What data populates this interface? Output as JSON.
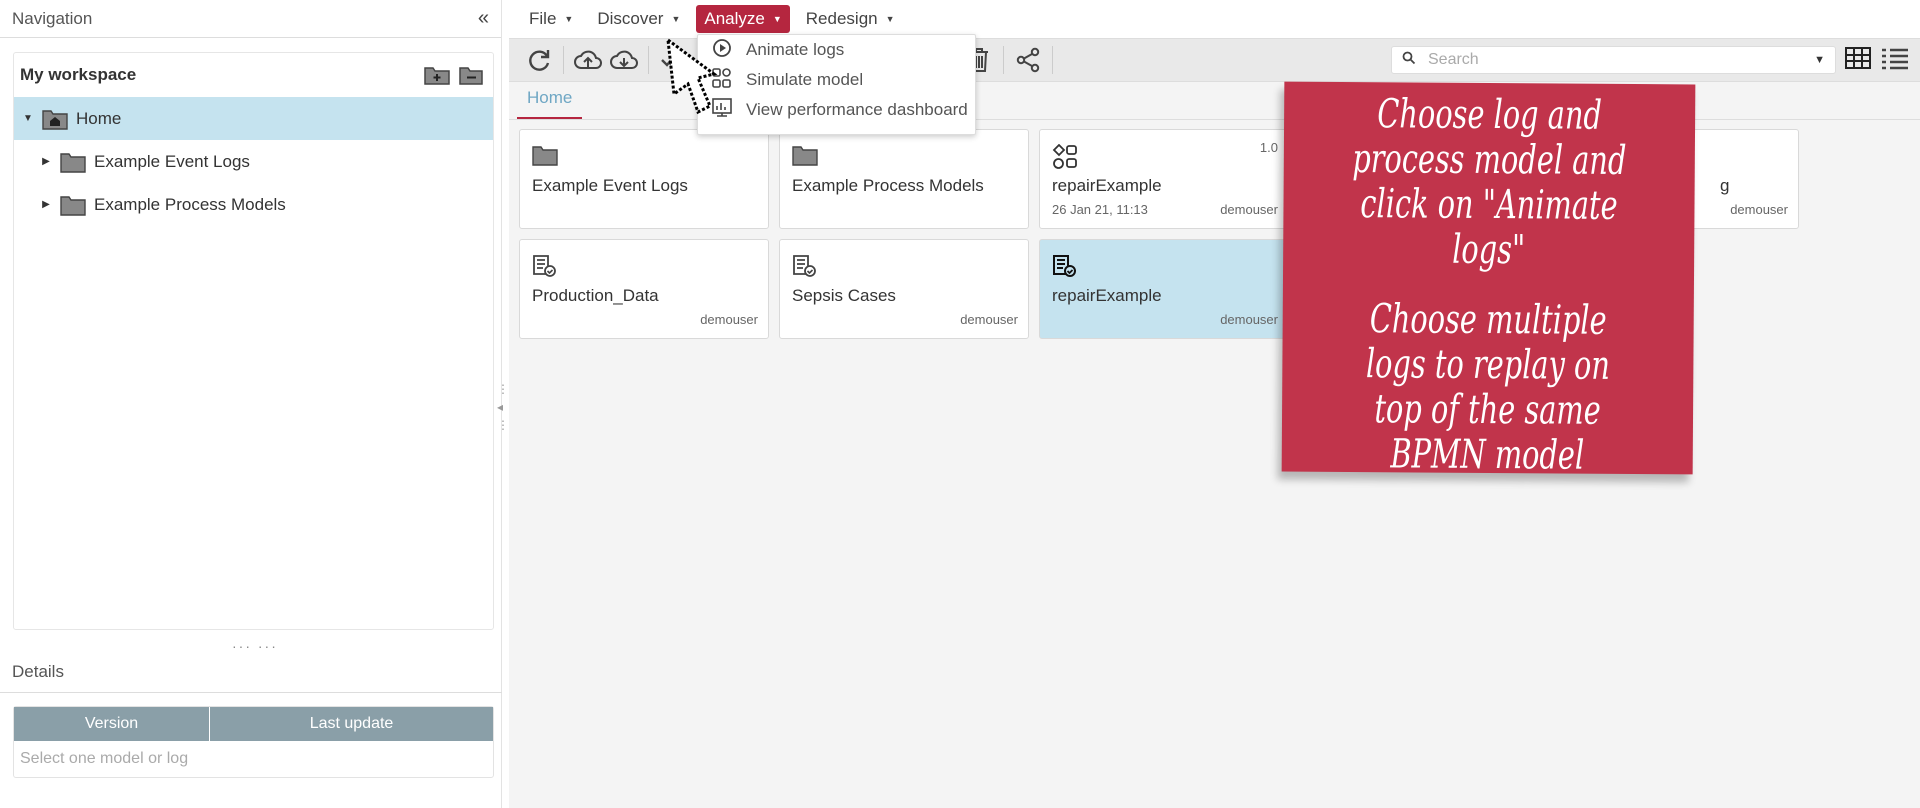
{
  "navigation": {
    "title": "Navigation",
    "workspace_title": "My workspace",
    "tree": [
      {
        "label": "Home",
        "selected": true
      },
      {
        "label": "Example Event Logs"
      },
      {
        "label": "Example Process Models"
      }
    ]
  },
  "details": {
    "title": "Details",
    "columns": [
      "Version",
      "Last update"
    ],
    "empty_text": "Select one model or log"
  },
  "menubar": {
    "items": [
      "File",
      "Discover",
      "Analyze",
      "Redesign"
    ],
    "active": "Analyze"
  },
  "analyze_menu": {
    "items": [
      "Animate logs",
      "Simulate model",
      "View performance dashboard"
    ]
  },
  "search": {
    "placeholder": "Search"
  },
  "breadcrumb": {
    "home": "Home"
  },
  "cards": [
    {
      "name": "Example Event Logs",
      "icon": "folder-icon"
    },
    {
      "name": "Example Process Models",
      "icon": "folder-icon"
    },
    {
      "name": "repairExample",
      "icon": "process-model-icon",
      "version": "1.0",
      "date": "26 Jan 21, 11:13",
      "owner": "demouser"
    },
    {
      "name": "g",
      "owner": "demouser"
    },
    {
      "name": "Production_Data",
      "icon": "event-log-icon",
      "owner": "demouser"
    },
    {
      "name": "Sepsis Cases",
      "icon": "event-log-icon",
      "owner": "demouser"
    },
    {
      "name": "repairExample",
      "icon": "event-log-icon",
      "owner": "demouser",
      "selected": true
    }
  ],
  "note": {
    "line1": "Choose log and process model and click on \"Animate logs\"",
    "line2": "Choose multiple logs to replay on top of the same BPMN model",
    "color": "#c1344b"
  },
  "colors": {
    "accent": "#b5263f",
    "selection": "#c5e3ef",
    "link": "#6fa7c4"
  }
}
